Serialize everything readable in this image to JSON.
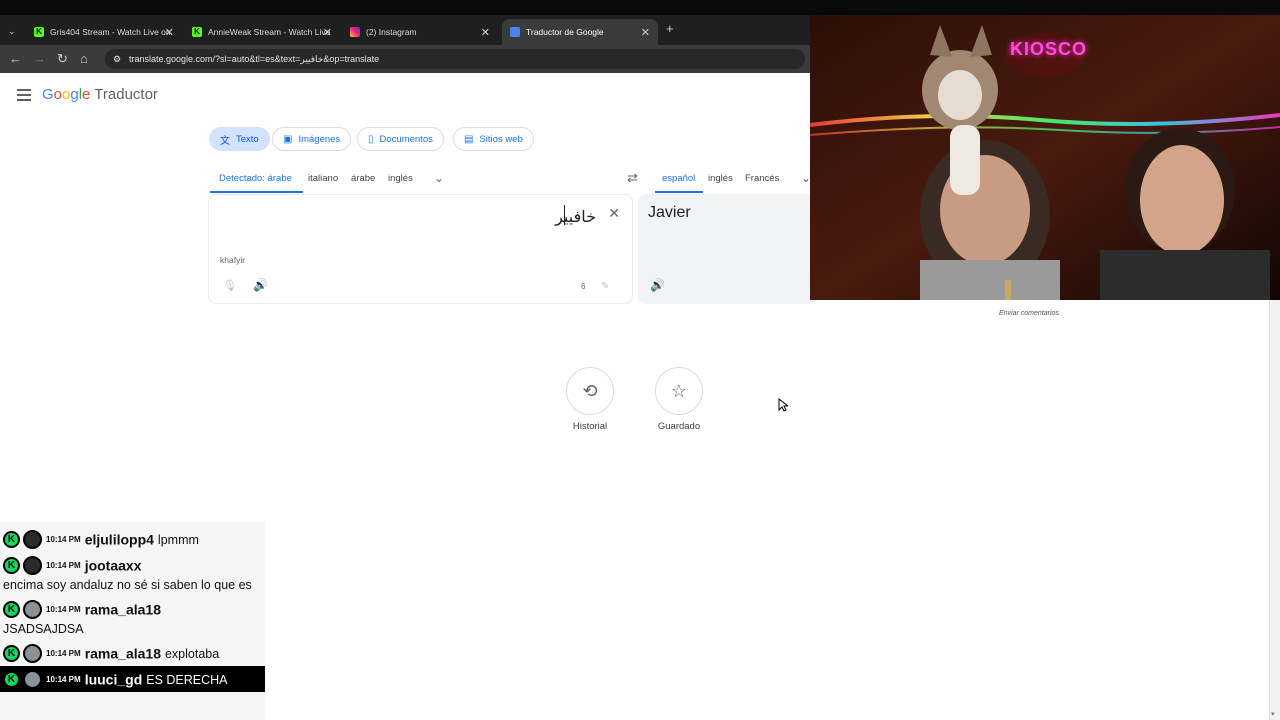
{
  "browser": {
    "tabs": [
      {
        "title": "Gris404 Stream - Watch Live on",
        "favicon": "kick-icon"
      },
      {
        "title": "AnnieWeak Stream - Watch Live",
        "favicon": "kick-icon"
      },
      {
        "title": "(2) Instagram",
        "favicon": "instagram-icon"
      },
      {
        "title": "Traductor de Google",
        "favicon": "google-translate-icon",
        "active": true
      }
    ],
    "new_tab": "+",
    "url": "translate.google.com/?sl=auto&tl=es&text=خافيير&op=translate"
  },
  "translate": {
    "logo_google": "Google",
    "logo_product": "Traductor",
    "modes": [
      "Texto",
      "Imágenes",
      "Documentos",
      "Sitios web"
    ],
    "source_langs": [
      "Detectado: árabe",
      "italiano",
      "árabe",
      "inglés"
    ],
    "target_langs": [
      "español",
      "inglés",
      "Francés"
    ],
    "source_text": "خافيير",
    "transliteration": "khafyir",
    "char_count": "6",
    "translation": "Javier",
    "history_label": "Historial",
    "saved_label": "Guardado",
    "feedback_label": "Enviar comentarios",
    "accent_color": "#1a73e8"
  },
  "webcam": {
    "sign_text": "KIOSCO"
  },
  "chat": {
    "messages": [
      {
        "time": "10:14 PM",
        "user": "eljulilopp4",
        "text": "lpmmm"
      },
      {
        "time": "10:14 PM",
        "user": "jootaaxx",
        "text": "encima soy andaluz no sé si saben lo que es"
      },
      {
        "time": "10:14 PM",
        "user": "rama_ala18",
        "text": "JSADSAJDSA"
      },
      {
        "time": "10:14 PM",
        "user": "rama_ala18",
        "text": "explotaba"
      },
      {
        "time": "10:14 PM",
        "user": "luuci_gd",
        "text": "ES DERECHA"
      }
    ]
  }
}
